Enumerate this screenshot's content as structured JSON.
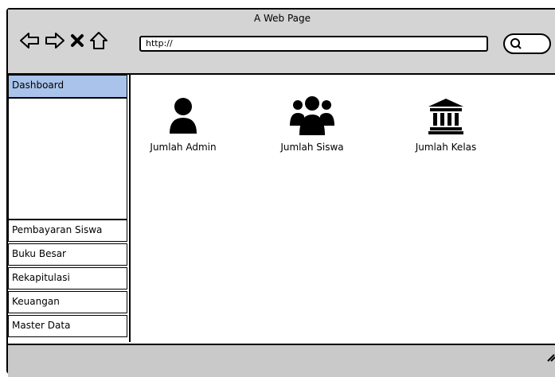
{
  "window": {
    "title": "A Web Page",
    "url": "http://"
  },
  "icons": {
    "back": "back-arrow-icon",
    "forward": "forward-arrow-icon",
    "stop": "close-icon",
    "home": "home-icon",
    "search": "search-icon",
    "resize": "resize-grip-icon"
  },
  "sidebar": {
    "active": "Dashboard",
    "items": [
      "Pembayaran Siswa",
      "Buku Besar",
      "Rekapitulasi",
      "Keuangan",
      "Master Data"
    ]
  },
  "dashboard": {
    "cards": [
      {
        "label": "Jumlah Admin",
        "icon": "user-icon"
      },
      {
        "label": "Jumlah Siswa",
        "icon": "users-group-icon"
      },
      {
        "label": "Jumlah Kelas",
        "icon": "institution-icon"
      }
    ]
  },
  "colors": {
    "chrome": "#d4d4d4",
    "active_tab": "#a9c3ea",
    "status_bar": "#c9c9c9"
  }
}
